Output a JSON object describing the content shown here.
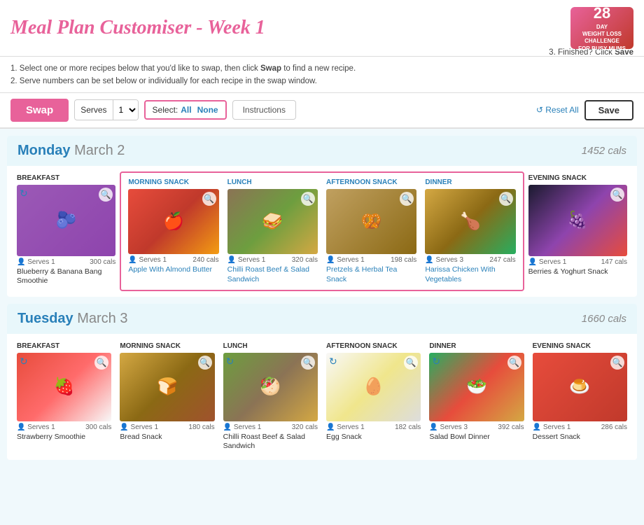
{
  "header": {
    "title": "Meal Plan Customiser - Week 1",
    "logo": {
      "big": "28",
      "line1": "DAY",
      "line2": "WEIGHT LOSS CHALLENGE",
      "line3": "FOR BUSY MUMS"
    }
  },
  "instructions": {
    "line1": "1. Select one or more recipes below that you'd like to swap, then click",
    "swap_bold": "Swap",
    "line1b": "to find a new recipe.",
    "line2": "2. Serve numbers can be set below or individually for each recipe in the swap window.",
    "right": "3. Finished? Click",
    "save_bold": "Save"
  },
  "toolbar": {
    "swap_label": "Swap",
    "serves_label": "Serves",
    "select_label": "Select:",
    "select_all": "All",
    "select_none": "None",
    "instructions_label": "Instructions",
    "reset_label": "↺ Reset All",
    "save_label": "Save"
  },
  "days": [
    {
      "id": "monday",
      "day_name": "Monday",
      "date": "March 2",
      "cals": "1452 cals",
      "selected_range": [
        1,
        4
      ],
      "meals": [
        {
          "type": "BREAKFAST",
          "selected": false,
          "serves": "Serves 1",
          "cals": "300 cals",
          "name": "Blueberry & Banana Bang Smoothie",
          "food_class": "food-smoothie",
          "has_refresh": true,
          "emoji": "🫐"
        },
        {
          "type": "MORNING SNACK",
          "selected": true,
          "serves": "Serves 1",
          "cals": "240 cals",
          "name": "Apple With Almond Butter",
          "food_class": "food-apple",
          "has_refresh": false,
          "emoji": "🍎"
        },
        {
          "type": "LUNCH",
          "selected": true,
          "serves": "Serves 1",
          "cals": "320 cals",
          "name": "Chilli Roast Beef & Salad Sandwich",
          "food_class": "food-sandwich",
          "has_refresh": false,
          "emoji": "🥪"
        },
        {
          "type": "AFTERNOON SNACK",
          "selected": true,
          "serves": "Serves 1",
          "cals": "198 cals",
          "name": "Pretzels & Herbal Tea Snack",
          "food_class": "food-pretzels",
          "has_refresh": false,
          "emoji": "🥨"
        },
        {
          "type": "DINNER",
          "selected": true,
          "serves": "Serves 3",
          "cals": "247 cals",
          "name": "Harissa Chicken With Vegetables",
          "food_class": "food-chicken",
          "has_refresh": false,
          "emoji": "🍗"
        },
        {
          "type": "EVENING SNACK",
          "selected": false,
          "serves": "Serves 1",
          "cals": "147 cals",
          "name": "Berries & Yoghurt Snack",
          "food_class": "food-berries",
          "has_refresh": false,
          "emoji": "🍇"
        }
      ]
    },
    {
      "id": "tuesday",
      "day_name": "Tuesday",
      "date": "March 3",
      "cals": "1660 cals",
      "selected_range": [],
      "meals": [
        {
          "type": "BREAKFAST",
          "selected": false,
          "serves": "Serves 1",
          "cals": "300 cals",
          "name": "Strawberry Smoothie",
          "food_class": "food-strawberry",
          "has_refresh": true,
          "emoji": "🍓"
        },
        {
          "type": "MORNING SNACK",
          "selected": false,
          "serves": "Serves 1",
          "cals": "180 cals",
          "name": "Bread Snack",
          "food_class": "food-bread",
          "has_refresh": false,
          "emoji": "🍞"
        },
        {
          "type": "LUNCH",
          "selected": false,
          "serves": "Serves 1",
          "cals": "320 cals",
          "name": "Chilli Roast Beef & Salad Sandwich",
          "food_class": "food-sandwich2",
          "has_refresh": true,
          "emoji": "🥙"
        },
        {
          "type": "AFTERNOON SNACK",
          "selected": false,
          "serves": "Serves 1",
          "cals": "182 cals",
          "name": "Egg Snack",
          "food_class": "food-egg",
          "has_refresh": true,
          "emoji": "🥚"
        },
        {
          "type": "DINNER",
          "selected": false,
          "serves": "Serves 3",
          "cals": "392 cals",
          "name": "Salad Bowl Dinner",
          "food_class": "food-salad-bowl",
          "has_refresh": true,
          "emoji": "🥗"
        },
        {
          "type": "EVENING SNACK",
          "selected": false,
          "serves": "Serves 1",
          "cals": "286 cals",
          "name": "Dessert Snack",
          "food_class": "food-dessert",
          "has_refresh": false,
          "emoji": "🍮"
        }
      ]
    }
  ]
}
